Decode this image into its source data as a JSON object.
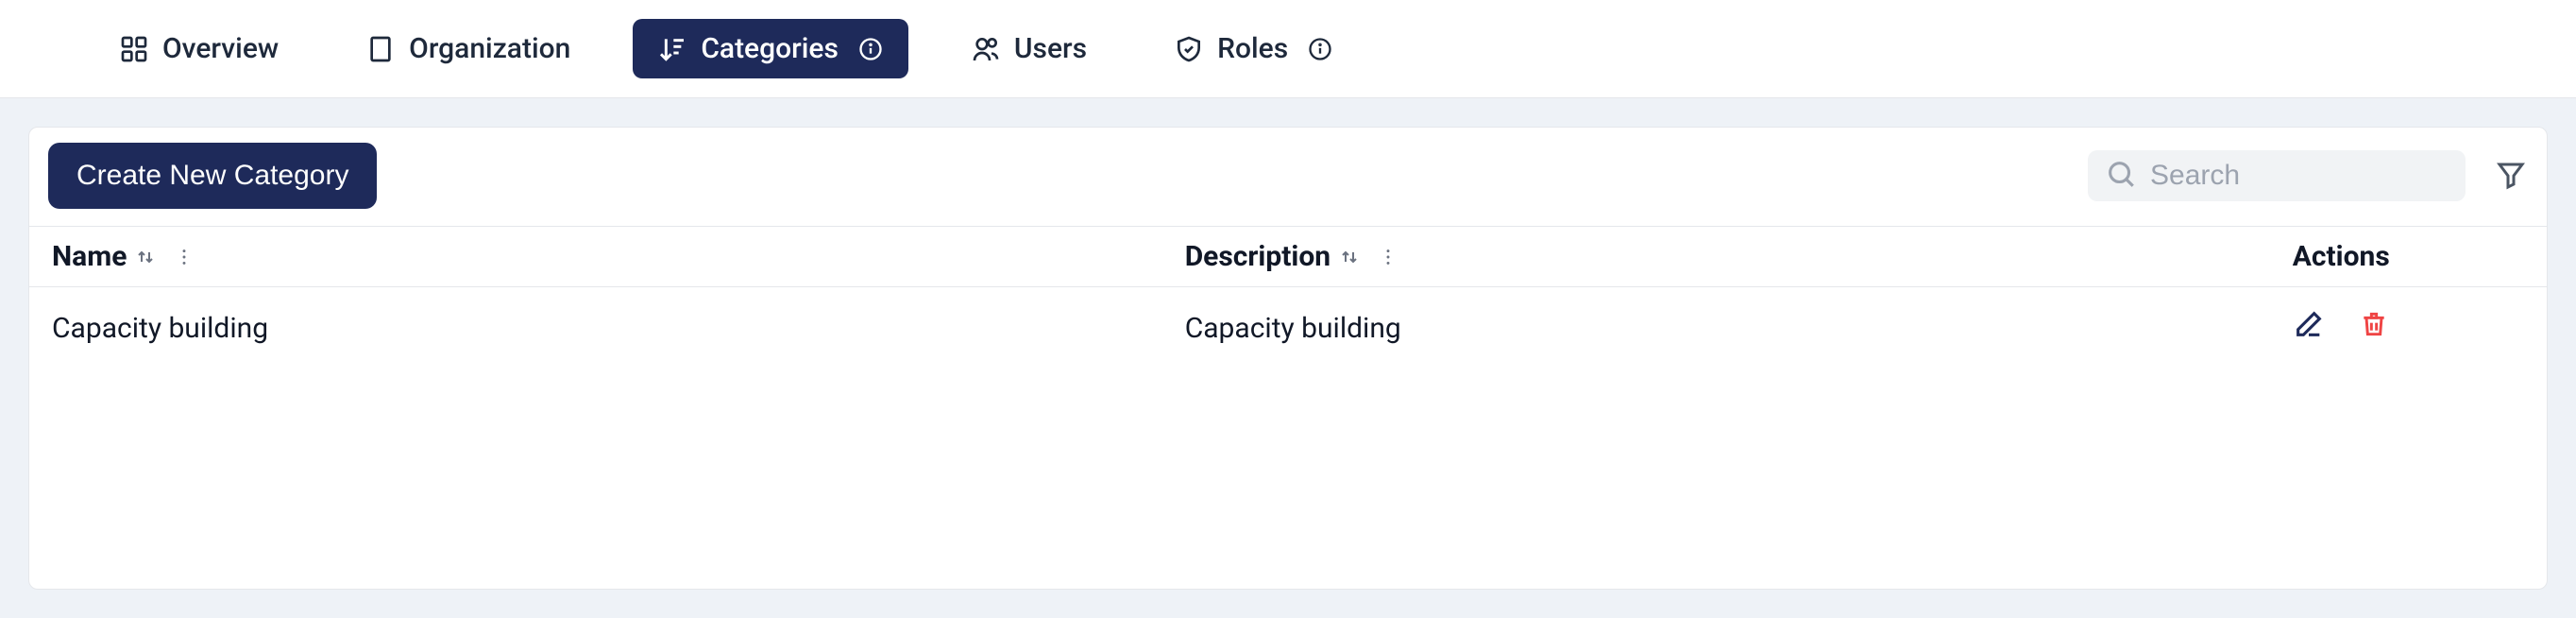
{
  "nav": {
    "items": [
      {
        "id": "overview",
        "label": "Overview",
        "icon": "grid"
      },
      {
        "id": "organization",
        "label": "Organization",
        "icon": "building"
      },
      {
        "id": "categories",
        "label": "Categories",
        "icon": "sort",
        "active": true,
        "info": true
      },
      {
        "id": "users",
        "label": "Users",
        "icon": "users"
      },
      {
        "id": "roles",
        "label": "Roles",
        "icon": "shield",
        "info": true
      }
    ]
  },
  "toolbar": {
    "create_label": "Create New Category",
    "search_placeholder": "Search"
  },
  "table": {
    "columns": [
      {
        "key": "name",
        "label": "Name",
        "sortable": true
      },
      {
        "key": "description",
        "label": "Description",
        "sortable": true
      },
      {
        "key": "actions",
        "label": "Actions"
      }
    ],
    "rows": [
      {
        "name": "Capacity building",
        "description": "Capacity building"
      }
    ]
  }
}
